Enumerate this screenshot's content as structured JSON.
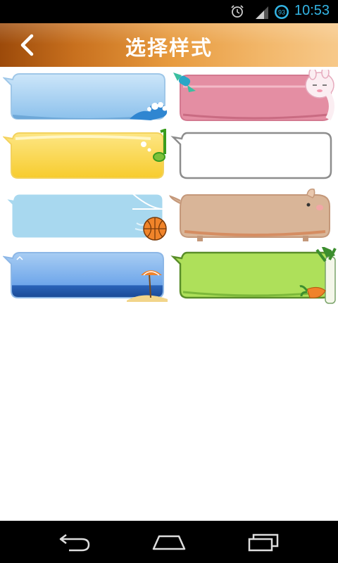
{
  "status_bar": {
    "time": "10:53",
    "battery_level": "93",
    "icons": [
      "alarm-icon",
      "signal-icon",
      "battery-icon"
    ]
  },
  "header": {
    "title": "选择样式",
    "back_icon": "chevron-left-icon"
  },
  "bubble_styles": [
    {
      "id": "ocean-wave",
      "color": "#a9d3f2"
    },
    {
      "id": "pink-bunny",
      "color": "#e48ea3"
    },
    {
      "id": "yellow-music",
      "color": "#fbd847"
    },
    {
      "id": "plain-white",
      "color": "#ffffff"
    },
    {
      "id": "basketball",
      "color": "#a8d8ef"
    },
    {
      "id": "piggy",
      "color": "#d9b598"
    },
    {
      "id": "beach",
      "color": "#86b7ee"
    },
    {
      "id": "leek-carrot",
      "color": "#aee05a"
    }
  ],
  "nav_bar": {
    "buttons": [
      "back-nav-icon",
      "home-nav-icon",
      "recents-nav-icon"
    ]
  }
}
